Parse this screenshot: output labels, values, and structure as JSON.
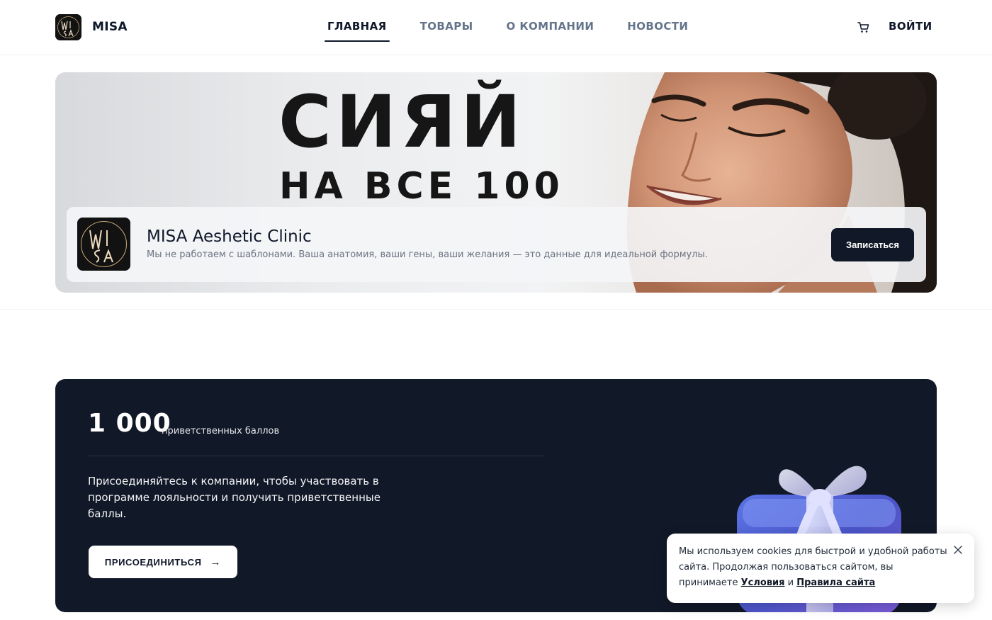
{
  "header": {
    "brand": "MISA",
    "nav": [
      {
        "label": "ГЛАВНАЯ",
        "active": true
      },
      {
        "label": "ТОВАРЫ",
        "active": false
      },
      {
        "label": "О КОМПАНИИ",
        "active": false
      },
      {
        "label": "НОВОСТИ",
        "active": false
      }
    ],
    "cart_icon": "cart-icon",
    "login_label": "ВОЙТИ"
  },
  "banner": {
    "headline": "СИЯЙ",
    "subheadline": "НА ВСЕ 100",
    "card": {
      "title": "MISA Aeshetic Clinic",
      "description": "Мы не работаем с шаблонами. Ваша анатомия, ваши гены, ваши желания — это данные для идеальной формулы.",
      "button_label": "Записаться"
    }
  },
  "loyalty": {
    "points": "1 000",
    "points_label": "приветственных баллов",
    "text": "Присоединяйтесь к компании, чтобы участвовать в программе лояльности и получить приветственные баллы.",
    "button_label": "ПРИСОЕДИНИТЬСЯ",
    "button_icon": "arrow-right-icon"
  },
  "cookie": {
    "text_before": "Мы используем cookies для быстрой и удобной работы сайта. Продолжая пользоваться сайтом, вы принимаете",
    "link_terms": "Условия",
    "conjunction": "и",
    "link_rules": "Правила сайта",
    "close_icon": "close-icon"
  },
  "colors": {
    "primary_dark": "#111827",
    "text_muted": "#64748b",
    "background": "#ffffff"
  }
}
